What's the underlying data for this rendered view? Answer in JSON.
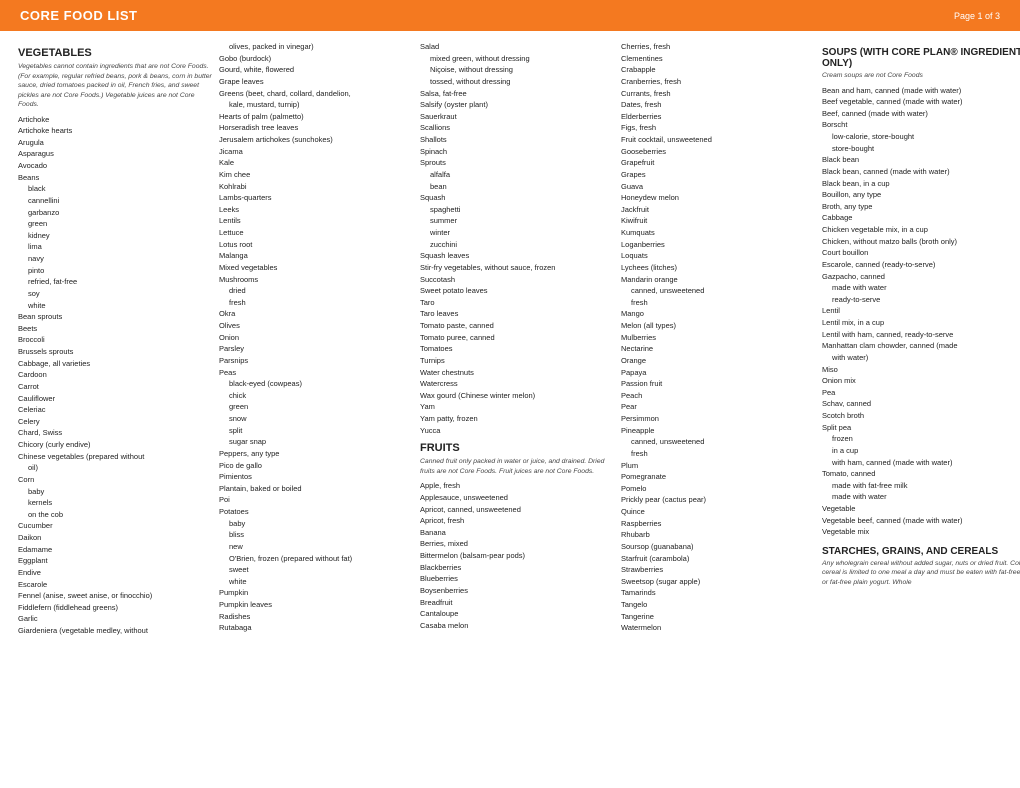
{
  "header": {
    "title": "CORE FOOD LIST",
    "page": "Page 1 of 3"
  },
  "columns": {
    "col1": {
      "section": "VEGETABLES",
      "subtitle": "Vegetables cannot contain ingredients that are not Core Foods. (For example, regular refried beans, pork & beans, corn in butter sauce, dried tomatoes packed in oil, French fries, and sweet pickles are not Core Foods.) Vegetable juices are not Core Foods.",
      "items": [
        {
          "text": "Artichoke",
          "indent": 0
        },
        {
          "text": "Artichoke hearts",
          "indent": 0
        },
        {
          "text": "Arugula",
          "indent": 0
        },
        {
          "text": "Asparagus",
          "indent": 0
        },
        {
          "text": "Avocado",
          "indent": 0
        },
        {
          "text": "Beans",
          "indent": 0
        },
        {
          "text": "black",
          "indent": 1
        },
        {
          "text": "cannellini",
          "indent": 1
        },
        {
          "text": "garbanzo",
          "indent": 1
        },
        {
          "text": "green",
          "indent": 1
        },
        {
          "text": "kidney",
          "indent": 1
        },
        {
          "text": "lima",
          "indent": 1
        },
        {
          "text": "navy",
          "indent": 1
        },
        {
          "text": "pinto",
          "indent": 1
        },
        {
          "text": "refried, fat-free",
          "indent": 1
        },
        {
          "text": "soy",
          "indent": 1
        },
        {
          "text": "white",
          "indent": 1
        },
        {
          "text": "Bean sprouts",
          "indent": 0
        },
        {
          "text": "Beets",
          "indent": 0
        },
        {
          "text": "Broccoli",
          "indent": 0
        },
        {
          "text": "Brussels sprouts",
          "indent": 0
        },
        {
          "text": "Cabbage, all varieties",
          "indent": 0
        },
        {
          "text": "Cardoon",
          "indent": 0
        },
        {
          "text": "Carrot",
          "indent": 0
        },
        {
          "text": "Cauliflower",
          "indent": 0
        },
        {
          "text": "Celeriac",
          "indent": 0
        },
        {
          "text": "Celery",
          "indent": 0
        },
        {
          "text": "Chard, Swiss",
          "indent": 0
        },
        {
          "text": "Chicory (curly endive)",
          "indent": 0
        },
        {
          "text": "Chinese vegetables (prepared without",
          "indent": 0
        },
        {
          "text": "oil)",
          "indent": 1
        },
        {
          "text": "Corn",
          "indent": 0
        },
        {
          "text": "baby",
          "indent": 1
        },
        {
          "text": "kernels",
          "indent": 1
        },
        {
          "text": "on the cob",
          "indent": 1
        },
        {
          "text": "Cucumber",
          "indent": 0
        },
        {
          "text": "Daikon",
          "indent": 0
        },
        {
          "text": "Edamame",
          "indent": 0
        },
        {
          "text": "Eggplant",
          "indent": 0
        },
        {
          "text": "Endive",
          "indent": 0
        },
        {
          "text": "Escarole",
          "indent": 0
        },
        {
          "text": "Fennel (anise, sweet anise, or finocchio)",
          "indent": 0
        },
        {
          "text": "Fiddlefern (fiddlehead greens)",
          "indent": 0
        },
        {
          "text": "Garlic",
          "indent": 0
        },
        {
          "text": "Giardeniera (vegetable medley, without",
          "indent": 0
        }
      ]
    },
    "col2": {
      "items": [
        {
          "text": "olives, packed in vinegar)",
          "indent": 1
        },
        {
          "text": "Gobo (burdock)",
          "indent": 0
        },
        {
          "text": "Gourd, white, flowered",
          "indent": 0
        },
        {
          "text": "Grape leaves",
          "indent": 0
        },
        {
          "text": "Greens (beet, chard, collard, dandelion,",
          "indent": 0
        },
        {
          "text": "kale, mustard, turnip)",
          "indent": 1
        },
        {
          "text": "Hearts of palm (palmetto)",
          "indent": 0
        },
        {
          "text": "Horseradish tree leaves",
          "indent": 0
        },
        {
          "text": "Jerusalem artichokes (sunchokes)",
          "indent": 0
        },
        {
          "text": "Jicama",
          "indent": 0
        },
        {
          "text": "Kale",
          "indent": 0
        },
        {
          "text": "Kim chee",
          "indent": 0
        },
        {
          "text": "Kohlrabi",
          "indent": 0
        },
        {
          "text": "Lambs-quarters",
          "indent": 0
        },
        {
          "text": "Leeks",
          "indent": 0
        },
        {
          "text": "Lentils",
          "indent": 0
        },
        {
          "text": "Lettuce",
          "indent": 0
        },
        {
          "text": "Lotus root",
          "indent": 0
        },
        {
          "text": "Malanga",
          "indent": 0
        },
        {
          "text": "Mixed vegetables",
          "indent": 0
        },
        {
          "text": "Mushrooms",
          "indent": 0
        },
        {
          "text": "dried",
          "indent": 1
        },
        {
          "text": "fresh",
          "indent": 1
        },
        {
          "text": "Okra",
          "indent": 0
        },
        {
          "text": "Olives",
          "indent": 0
        },
        {
          "text": "Onion",
          "indent": 0
        },
        {
          "text": "Parsley",
          "indent": 0
        },
        {
          "text": "Parsnips",
          "indent": 0
        },
        {
          "text": "Peas",
          "indent": 0
        },
        {
          "text": "black-eyed (cowpeas)",
          "indent": 1
        },
        {
          "text": "chick",
          "indent": 1
        },
        {
          "text": "green",
          "indent": 1
        },
        {
          "text": "snow",
          "indent": 1
        },
        {
          "text": "split",
          "indent": 1
        },
        {
          "text": "sugar snap",
          "indent": 1
        },
        {
          "text": "Peppers, any type",
          "indent": 0
        },
        {
          "text": "Pico de gallo",
          "indent": 0
        },
        {
          "text": "Pimientos",
          "indent": 0
        },
        {
          "text": "Plantain, baked or boiled",
          "indent": 0
        },
        {
          "text": "Poi",
          "indent": 0
        },
        {
          "text": "Potatoes",
          "indent": 0
        },
        {
          "text": "baby",
          "indent": 1
        },
        {
          "text": "bliss",
          "indent": 1
        },
        {
          "text": "new",
          "indent": 1
        },
        {
          "text": "O'Brien, frozen (prepared without fat)",
          "indent": 1
        },
        {
          "text": "sweet",
          "indent": 1
        },
        {
          "text": "white",
          "indent": 1
        },
        {
          "text": "Pumpkin",
          "indent": 0
        },
        {
          "text": "Pumpkin leaves",
          "indent": 0
        },
        {
          "text": "Radishes",
          "indent": 0
        },
        {
          "text": "Rutabaga",
          "indent": 0
        }
      ]
    },
    "col3": {
      "items": [
        {
          "text": "Salad",
          "indent": 0
        },
        {
          "text": "mixed green, without dressing",
          "indent": 1
        },
        {
          "text": "Niçoise, without dressing",
          "indent": 1
        },
        {
          "text": "tossed, without dressing",
          "indent": 1
        },
        {
          "text": "Salsa, fat-free",
          "indent": 0
        },
        {
          "text": "Salsify (oyster plant)",
          "indent": 0
        },
        {
          "text": "Sauerkraut",
          "indent": 0
        },
        {
          "text": "Scallions",
          "indent": 0
        },
        {
          "text": "Shallots",
          "indent": 0
        },
        {
          "text": "Spinach",
          "indent": 0
        },
        {
          "text": "Sprouts",
          "indent": 0
        },
        {
          "text": "alfalfa",
          "indent": 1
        },
        {
          "text": "bean",
          "indent": 1
        },
        {
          "text": "Squash",
          "indent": 0
        },
        {
          "text": "spaghetti",
          "indent": 1
        },
        {
          "text": "summer",
          "indent": 1
        },
        {
          "text": "winter",
          "indent": 1
        },
        {
          "text": "zucchini",
          "indent": 1
        },
        {
          "text": "Squash leaves",
          "indent": 0
        },
        {
          "text": "Stir-fry vegetables, without sauce, frozen",
          "indent": 0
        },
        {
          "text": "Succotash",
          "indent": 0
        },
        {
          "text": "Sweet potato leaves",
          "indent": 0
        },
        {
          "text": "Taro",
          "indent": 0
        },
        {
          "text": "Taro leaves",
          "indent": 0
        },
        {
          "text": "Tomato paste, canned",
          "indent": 0
        },
        {
          "text": "Tomato puree, canned",
          "indent": 0
        },
        {
          "text": "Tomatoes",
          "indent": 0
        },
        {
          "text": "Turnips",
          "indent": 0
        },
        {
          "text": "Water chestnuts",
          "indent": 0
        },
        {
          "text": "Watercress",
          "indent": 0
        },
        {
          "text": "Wax gourd (Chinese winter melon)",
          "indent": 0
        },
        {
          "text": "Yam",
          "indent": 0
        },
        {
          "text": "Yam patty, frozen",
          "indent": 0
        },
        {
          "text": "Yucca",
          "indent": 0
        },
        {
          "text": "FRUITS",
          "indent": 0,
          "type": "section"
        },
        {
          "text": "Canned fruit only packed in water or juice, and drained. Dried fruits are not Core Foods. Fruit juices are not Core Foods.",
          "indent": 0,
          "type": "subtitle"
        },
        {
          "text": "Apple, fresh",
          "indent": 0
        },
        {
          "text": "Applesauce, unsweetened",
          "indent": 0
        },
        {
          "text": "Apricot, canned, unsweetened",
          "indent": 0
        },
        {
          "text": "Apricot, fresh",
          "indent": 0
        },
        {
          "text": "Banana",
          "indent": 0
        },
        {
          "text": "Berries, mixed",
          "indent": 0
        },
        {
          "text": "Bittermelon (balsam-pear pods)",
          "indent": 0
        },
        {
          "text": "Blackberries",
          "indent": 0
        },
        {
          "text": "Blueberries",
          "indent": 0
        },
        {
          "text": "Boysenberries",
          "indent": 0
        },
        {
          "text": "Breadfruit",
          "indent": 0
        },
        {
          "text": "Cantaloupe",
          "indent": 0
        },
        {
          "text": "Casaba melon",
          "indent": 0
        }
      ]
    },
    "col4": {
      "items": [
        {
          "text": "Cherries, fresh",
          "indent": 0
        },
        {
          "text": "Clementines",
          "indent": 0
        },
        {
          "text": "Crabapple",
          "indent": 0
        },
        {
          "text": "Cranberries, fresh",
          "indent": 0
        },
        {
          "text": "Currants, fresh",
          "indent": 0
        },
        {
          "text": "Dates, fresh",
          "indent": 0
        },
        {
          "text": "Elderberries",
          "indent": 0
        },
        {
          "text": "Figs, fresh",
          "indent": 0
        },
        {
          "text": "Fruit cocktail, unsweetened",
          "indent": 0
        },
        {
          "text": "Gooseberries",
          "indent": 0
        },
        {
          "text": "Grapefruit",
          "indent": 0
        },
        {
          "text": "Grapes",
          "indent": 0
        },
        {
          "text": "Guava",
          "indent": 0
        },
        {
          "text": "Honeydew melon",
          "indent": 0
        },
        {
          "text": "Jackfruit",
          "indent": 0
        },
        {
          "text": "Kiwifruit",
          "indent": 0
        },
        {
          "text": "Kumquats",
          "indent": 0
        },
        {
          "text": "Loganberries",
          "indent": 0
        },
        {
          "text": "Loquats",
          "indent": 0
        },
        {
          "text": "Lychees (litches)",
          "indent": 0
        },
        {
          "text": "Mandarin orange",
          "indent": 0
        },
        {
          "text": "canned, unsweetened",
          "indent": 1
        },
        {
          "text": "fresh",
          "indent": 1
        },
        {
          "text": "Mango",
          "indent": 0
        },
        {
          "text": "Melon (all types)",
          "indent": 0
        },
        {
          "text": "Mulberries",
          "indent": 0
        },
        {
          "text": "Nectarine",
          "indent": 0
        },
        {
          "text": "Orange",
          "indent": 0
        },
        {
          "text": "Papaya",
          "indent": 0
        },
        {
          "text": "Passion fruit",
          "indent": 0
        },
        {
          "text": "Peach",
          "indent": 0
        },
        {
          "text": "Pear",
          "indent": 0
        },
        {
          "text": "Persimmon",
          "indent": 0
        },
        {
          "text": "Pineapple",
          "indent": 0
        },
        {
          "text": "canned, unsweetened",
          "indent": 1
        },
        {
          "text": "fresh",
          "indent": 1
        },
        {
          "text": "Plum",
          "indent": 0
        },
        {
          "text": "Pomegranate",
          "indent": 0
        },
        {
          "text": "Pomelo",
          "indent": 0
        },
        {
          "text": "Prickly pear (cactus pear)",
          "indent": 0
        },
        {
          "text": "Quince",
          "indent": 0
        },
        {
          "text": "Raspberries",
          "indent": 0
        },
        {
          "text": "Rhubarb",
          "indent": 0
        },
        {
          "text": "Soursop (guanabana)",
          "indent": 0
        },
        {
          "text": "Starfruit (carambola)",
          "indent": 0
        },
        {
          "text": "Strawberries",
          "indent": 0
        },
        {
          "text": "Sweetsop (sugar apple)",
          "indent": 0
        },
        {
          "text": "Tamarinds",
          "indent": 0
        },
        {
          "text": "Tangelo",
          "indent": 0
        },
        {
          "text": "Tangerine",
          "indent": 0
        },
        {
          "text": "Watermelon",
          "indent": 0
        }
      ]
    },
    "col5": {
      "soups_title": "SOUPS (WITH CORE PLAN® INGREDIENTS ONLY)",
      "soups_subtitle": "Cream soups are not Core Foods",
      "soups_items": [
        {
          "text": "Bean and ham, canned (made with water)",
          "indent": 0
        },
        {
          "text": "Beef vegetable, canned (made with water)",
          "indent": 0
        },
        {
          "text": "Beef, canned (made with water)",
          "indent": 0
        },
        {
          "text": "Borscht",
          "indent": 0
        },
        {
          "text": "low-calorie, store-bought",
          "indent": 1
        },
        {
          "text": "store-bought",
          "indent": 1
        },
        {
          "text": "Black bean",
          "indent": 0
        },
        {
          "text": "Black bean, canned (made with water)",
          "indent": 0
        },
        {
          "text": "Black bean, in a cup",
          "indent": 0
        },
        {
          "text": "Bouillon, any type",
          "indent": 0
        },
        {
          "text": "Broth, any type",
          "indent": 0
        },
        {
          "text": "Cabbage",
          "indent": 0
        },
        {
          "text": "Chicken vegetable mix, in a cup",
          "indent": 0
        },
        {
          "text": "Chicken, without matzo balls (broth only)",
          "indent": 0
        },
        {
          "text": "Court bouillon",
          "indent": 0
        },
        {
          "text": "Escarole, canned (ready-to-serve)",
          "indent": 0
        },
        {
          "text": "Gazpacho, canned",
          "indent": 0
        },
        {
          "text": "made with water",
          "indent": 1
        },
        {
          "text": "ready-to-serve",
          "indent": 1
        },
        {
          "text": "Lentil",
          "indent": 0
        },
        {
          "text": "Lentil mix, in a cup",
          "indent": 0
        },
        {
          "text": "Lentil with ham, canned, ready-to-serve",
          "indent": 0
        },
        {
          "text": "Manhattan clam chowder, canned (made",
          "indent": 0
        },
        {
          "text": "with water)",
          "indent": 1
        },
        {
          "text": "Miso",
          "indent": 0
        },
        {
          "text": "Onion mix",
          "indent": 0
        },
        {
          "text": "Pea",
          "indent": 0
        },
        {
          "text": "Schav, canned",
          "indent": 0
        },
        {
          "text": "Scotch broth",
          "indent": 0
        },
        {
          "text": "Split pea",
          "indent": 0
        },
        {
          "text": "frozen",
          "indent": 1
        },
        {
          "text": "in a cup",
          "indent": 1
        },
        {
          "text": "with ham, canned (made with water)",
          "indent": 1
        },
        {
          "text": "Tomato, canned",
          "indent": 0
        },
        {
          "text": "made with fat-free milk",
          "indent": 1
        },
        {
          "text": "made with water",
          "indent": 1
        },
        {
          "text": "Vegetable",
          "indent": 0
        },
        {
          "text": "Vegetable beef, canned (made with water)",
          "indent": 0
        },
        {
          "text": "Vegetable mix",
          "indent": 0
        }
      ],
      "starches_title": "STARCHES, GRAINS, AND CEREALS",
      "starches_subtitle": "Any wholegrain cereal without added sugar, nuts or dried fruit. Cold cereal is limited to one meal a day and must be eaten with fat-free milk or fat-free plain yogurt. Whole"
    }
  }
}
